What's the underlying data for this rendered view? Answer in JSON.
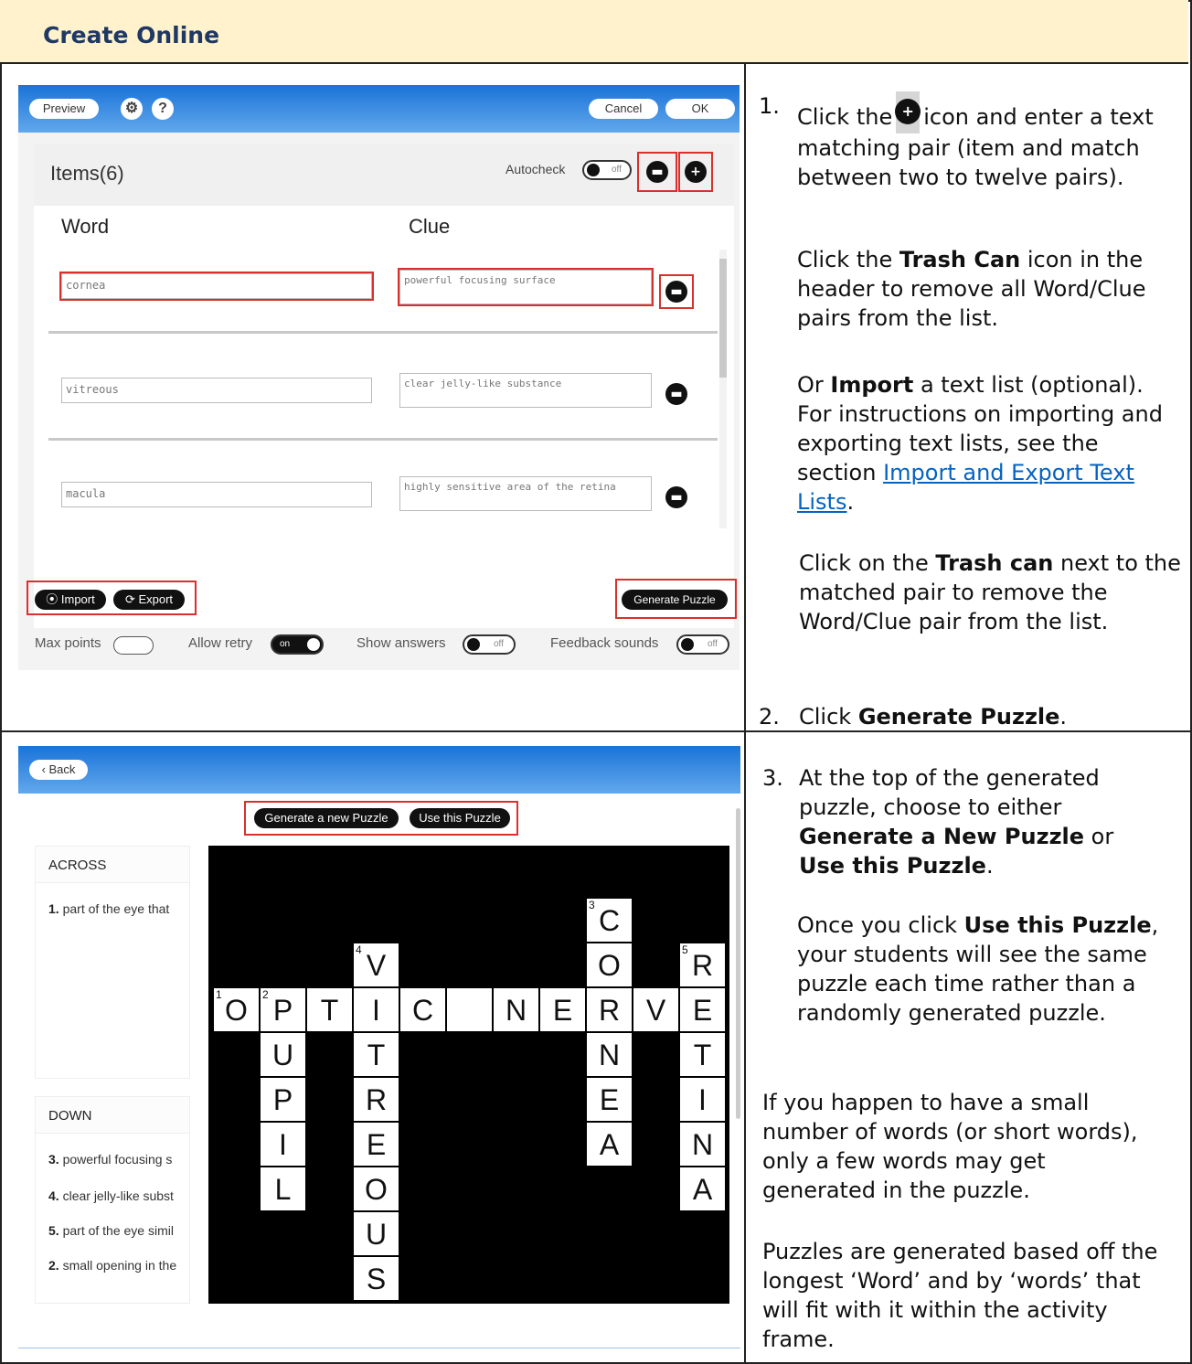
{
  "header": {
    "title": "Create Online"
  },
  "editor": {
    "preview": "Preview",
    "settings_icon": "gear-icon",
    "help": "?",
    "cancel": "Cancel",
    "ok": "OK",
    "items_title": "Items(6)",
    "autocheck_label": "Autocheck",
    "autocheck_state": "off",
    "plus": "+",
    "col_word": "Word",
    "col_clue": "Clue",
    "rows": [
      {
        "word": "cornea",
        "clue": "powerful focusing surface"
      },
      {
        "word": "vitreous",
        "clue": "clear jelly-like substance"
      },
      {
        "word": "macula",
        "clue": "highly sensitive area of the retina"
      }
    ],
    "import": "Import",
    "export": "Export",
    "generate": "Generate Puzzle",
    "max_points": "Max points",
    "allow_retry": "Allow retry",
    "allow_retry_state": "on",
    "show_answers": "Show answers",
    "show_answers_state": "off",
    "feedback_sounds": "Feedback sounds",
    "feedback_sounds_state": "off"
  },
  "puzzle": {
    "back": "Back",
    "new_puzzle": "Generate a new Puzzle",
    "use_puzzle": "Use this Puzzle",
    "across_title": "ACROSS",
    "down_title": "DOWN",
    "across": [
      {
        "num": "1.",
        "text": "part of the eye that"
      }
    ],
    "down": [
      {
        "num": "3.",
        "text": "powerful focusing s"
      },
      {
        "num": "4.",
        "text": "clear jelly-like subst"
      },
      {
        "num": "5.",
        "text": "part of the eye simil"
      },
      {
        "num": "2.",
        "text": "small opening in the"
      }
    ],
    "cells": [
      {
        "r": 0,
        "c": 8,
        "ch": "C",
        "n": "3"
      },
      {
        "r": 1,
        "c": 3,
        "ch": "V",
        "n": "4"
      },
      {
        "r": 1,
        "c": 8,
        "ch": "O",
        "n": ""
      },
      {
        "r": 1,
        "c": 10,
        "ch": "R",
        "n": "5"
      },
      {
        "r": 2,
        "c": 0,
        "ch": "O",
        "n": "1"
      },
      {
        "r": 2,
        "c": 1,
        "ch": "P",
        "n": "2"
      },
      {
        "r": 2,
        "c": 2,
        "ch": "T",
        "n": ""
      },
      {
        "r": 2,
        "c": 3,
        "ch": "I",
        "n": ""
      },
      {
        "r": 2,
        "c": 4,
        "ch": "C",
        "n": ""
      },
      {
        "r": 2,
        "c": 5,
        "ch": "",
        "n": ""
      },
      {
        "r": 2,
        "c": 6,
        "ch": "N",
        "n": ""
      },
      {
        "r": 2,
        "c": 7,
        "ch": "E",
        "n": ""
      },
      {
        "r": 2,
        "c": 8,
        "ch": "R",
        "n": ""
      },
      {
        "r": 2,
        "c": 9,
        "ch": "V",
        "n": ""
      },
      {
        "r": 2,
        "c": 10,
        "ch": "E",
        "n": ""
      },
      {
        "r": 3,
        "c": 1,
        "ch": "U",
        "n": ""
      },
      {
        "r": 3,
        "c": 3,
        "ch": "T",
        "n": ""
      },
      {
        "r": 3,
        "c": 8,
        "ch": "N",
        "n": ""
      },
      {
        "r": 3,
        "c": 10,
        "ch": "T",
        "n": ""
      },
      {
        "r": 4,
        "c": 1,
        "ch": "P",
        "n": ""
      },
      {
        "r": 4,
        "c": 3,
        "ch": "R",
        "n": ""
      },
      {
        "r": 4,
        "c": 8,
        "ch": "E",
        "n": ""
      },
      {
        "r": 4,
        "c": 10,
        "ch": "I",
        "n": ""
      },
      {
        "r": 5,
        "c": 1,
        "ch": "I",
        "n": ""
      },
      {
        "r": 5,
        "c": 3,
        "ch": "E",
        "n": ""
      },
      {
        "r": 5,
        "c": 8,
        "ch": "A",
        "n": ""
      },
      {
        "r": 5,
        "c": 10,
        "ch": "N",
        "n": ""
      },
      {
        "r": 6,
        "c": 1,
        "ch": "L",
        "n": ""
      },
      {
        "r": 6,
        "c": 3,
        "ch": "O",
        "n": ""
      },
      {
        "r": 6,
        "c": 10,
        "ch": "A",
        "n": ""
      },
      {
        "r": 7,
        "c": 3,
        "ch": "U",
        "n": ""
      },
      {
        "r": 8,
        "c": 3,
        "ch": "S",
        "n": ""
      }
    ]
  },
  "instructions": {
    "s1_num": "1.",
    "s1_a": "Click the",
    "s1_b": "icon and enter a text matching pair (item and match between two to twelve pairs).",
    "trash_a": "Click the ",
    "trash_b": "Trash Can",
    "trash_c": " icon in the header to remove all Word/Clue pairs from the list.",
    "import_a": "Or ",
    "import_b": "Import",
    "import_c": " a text list (optional).",
    "import_d": "For instructions on importing and exporting text lists, see the section ",
    "import_link": "Import and Export Text Lists",
    "import_e": ".",
    "trash2_a": "Click on the ",
    "trash2_b": "Trash can",
    "trash2_c": " next to the matched pair to remove the Word/Clue pair from the list.",
    "s2_num": "2.",
    "s2_a": "Click ",
    "s2_b": "Generate Puzzle",
    "s2_c": ".",
    "s3_num": "3.",
    "s3_a": "At the top of the generated puzzle, choose to either ",
    "s3_b": "Generate a New Puzzle",
    "s3_c": " or ",
    "s3_d": "Use this Puzzle",
    "s3_e": ".",
    "once_a": "Once you click ",
    "once_b": "Use this Puzzle",
    "once_c": ", your students will see the same puzzle each time rather than a randomly generated puzzle.",
    "small": "If you happen to have a small number of words (or short words), only a few words may get generated in the puzzle.",
    "longest": "Puzzles are generated based off the longest ‘Word’ and by ‘words’ that will fit with it within the activity frame."
  }
}
